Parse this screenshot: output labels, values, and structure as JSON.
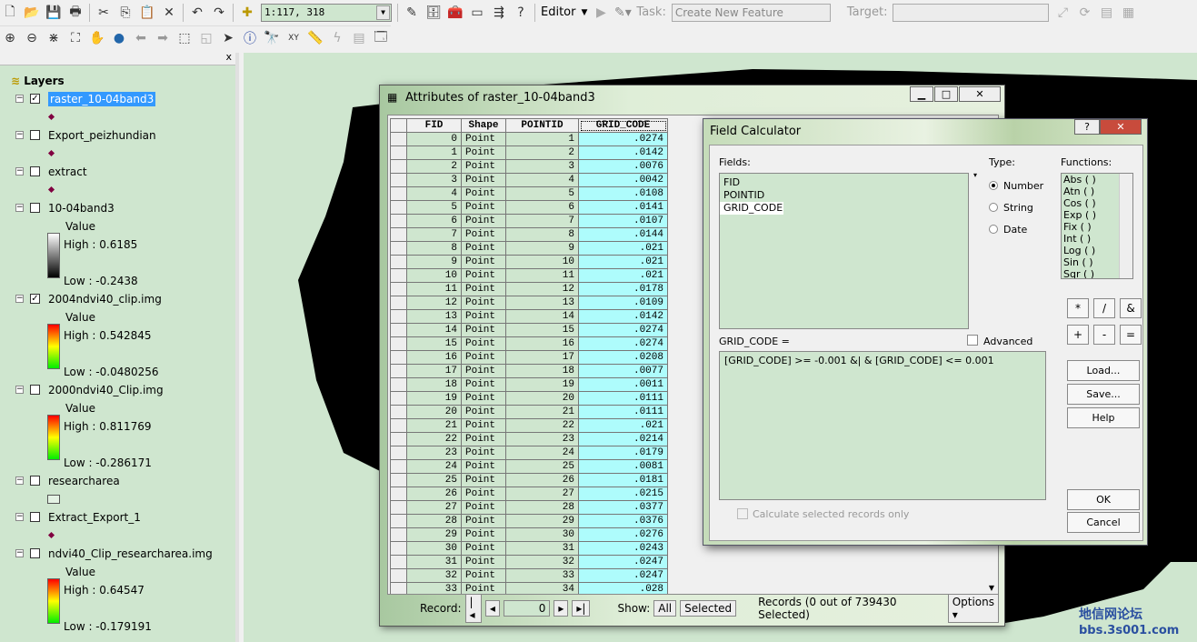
{
  "toolbar": {
    "scale": "1:117, 318",
    "editor": "Editor",
    "task_label": "Task:",
    "task_value": "Create New Feature",
    "target_label": "Target:"
  },
  "toc": {
    "title": "Layers",
    "close": "x",
    "items": [
      {
        "name": "raster_10-04band3",
        "checked": true,
        "selected": true
      },
      {
        "name": "Export_peizhundian",
        "checked": false
      },
      {
        "name": "extract",
        "checked": false
      },
      {
        "name": "10-04band3",
        "checked": false,
        "value_label": "Value",
        "high": "High : 0.6185",
        "low": "Low : -0.2438"
      },
      {
        "name": "2004ndvi40_clip.img",
        "checked": true,
        "value_label": "Value",
        "high": "High : 0.542845",
        "low": "Low : -0.0480256"
      },
      {
        "name": "2000ndvi40_Clip.img",
        "checked": false,
        "value_label": "Value",
        "high": "High : 0.811769",
        "low": "Low : -0.286171"
      },
      {
        "name": "researcharea",
        "checked": false
      },
      {
        "name": "Extract_Export_1",
        "checked": false
      },
      {
        "name": "ndvi40_Clip_researcharea.img",
        "checked": false,
        "value_label": "Value",
        "high": "High : 0.64547",
        "low": "Low : -0.179191"
      }
    ]
  },
  "attributes": {
    "title": "Attributes of raster_10-04band3",
    "columns": [
      "FID",
      "Shape",
      "POINTID",
      "GRID_CODE"
    ],
    "grid_code": [
      ".0274",
      ".0142",
      ".0076",
      ".0042",
      ".0108",
      ".0141",
      ".0107",
      ".0144",
      ".021",
      ".021",
      ".021",
      ".0178",
      ".0109",
      ".0142",
      ".0274",
      ".0274",
      ".0208",
      ".0077",
      ".0011",
      ".0111",
      ".0111",
      ".021",
      ".0214",
      ".0179",
      ".0081",
      ".0181",
      ".0215",
      ".0377",
      ".0376",
      ".0276",
      ".0243",
      ".0247",
      ".0247",
      ".028"
    ],
    "shape": "Point",
    "record_label": "Record:",
    "record_value": "0",
    "show_label": "Show:",
    "all": "All",
    "selected": "Selected",
    "records_status": "Records (0 out of 739430 Selected)",
    "options": "Options"
  },
  "field_calculator": {
    "title": "Field Calculator",
    "fields_label": "Fields:",
    "fields": [
      "FID",
      "POINTID",
      "GRID_CODE"
    ],
    "type_label": "Type:",
    "types": [
      "Number",
      "String",
      "Date"
    ],
    "type_selected": "Number",
    "functions_label": "Functions:",
    "functions": [
      "Abs ( )",
      "Atn ( )",
      "Cos ( )",
      "Exp ( )",
      "Fix ( )",
      "Int ( )",
      "Log ( )",
      "Sin ( )",
      "Sqr ( )"
    ],
    "operators": [
      "*",
      "/",
      "&",
      "+",
      "-",
      "="
    ],
    "expr_label": "GRID_CODE =",
    "advanced": "Advanced",
    "expression": "[GRID_CODE] >= -0.001 &| & [GRID_CODE] <= 0.001",
    "calc_selected": "Calculate selected records only",
    "load": "Load...",
    "save": "Save...",
    "help": "Help",
    "ok": "OK",
    "cancel": "Cancel"
  },
  "watermark": {
    "line1": "地信网论坛",
    "line2": "bbs.3s001.com"
  }
}
